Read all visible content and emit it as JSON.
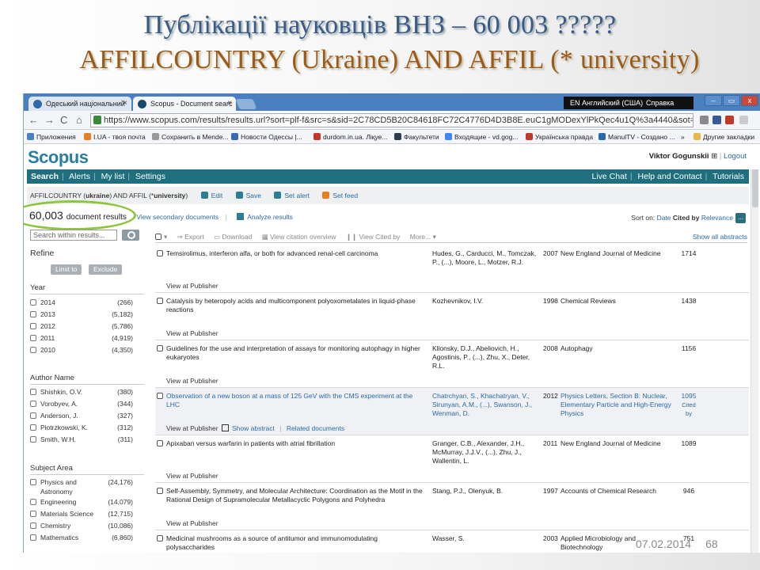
{
  "slide": {
    "title_line1": "Публікації науковців ВНЗ – 60 003 ?????",
    "title_line2": "AFFILCOUNTRY (Ukraine)  AND AFFIL (* university)",
    "date": "07.02.2014",
    "page": "68"
  },
  "browser": {
    "tabs": [
      {
        "label": "Одеський національний"
      },
      {
        "label": "Scopus - Document searc"
      }
    ],
    "tab_close": "×",
    "language": "EN Английский (США)",
    "help": "Справка",
    "url": "https://www.scopus.com/results/results.url?sort=plf-f&src=s&sid=2C78CD5B20C84618FC72C4776D4D3B8E.euC1gMODexYlPkQec4u1Q%3a4440&sot=",
    "bookmarks": [
      "Приложения",
      "I.UA - твоя почта",
      "Сохранить в Mende...",
      "Новости Одессы |...",
      "durdom.in.ua. Ліқуе...",
      "Факультети",
      "Входящие - vd.gog...",
      "Українська правда",
      "ManulTV - Создано ...",
      "»",
      "Другие закладки"
    ]
  },
  "scopus": {
    "logo": "Scopus",
    "user": "Viktor Gogunskii",
    "user_box": "⊞",
    "logout": "Logout",
    "nav_left": [
      "Search",
      "Alerts",
      "My list",
      "Settings"
    ],
    "nav_right": [
      "Live Chat",
      "Help and Contact",
      "Tutorials"
    ],
    "query_prefix": "AFFILCOUNTRY (",
    "query_bold1": "ukraine",
    "query_mid": ") AND AFFIL (*",
    "query_bold2": "university",
    "query_suffix": ")",
    "query_actions": [
      "Edit",
      "Save",
      "Set alert",
      "Set feed"
    ],
    "results_count": "60,003",
    "results_label": "document results",
    "view_secondary": "View secondary documents",
    "analyze": "Analyze results",
    "sort_on": "Sort on:",
    "sort_options": [
      "Date",
      "Cited by",
      "Relevance"
    ],
    "sort_more": "...",
    "search_within_placeholder": "Search within results...",
    "refine": "Refine",
    "limit_to": "Limit to",
    "exclude": "Exclude",
    "toolbar": [
      "Export",
      "Download",
      "View citation overview",
      "View Cited by",
      "More..."
    ],
    "show_all_abstracts": "Show all abstracts",
    "facets": [
      {
        "title": "Year",
        "items": [
          [
            "2014",
            "(266)"
          ],
          [
            "2013",
            "(5,182)"
          ],
          [
            "2012",
            "(5,786)"
          ],
          [
            "2011",
            "(4,919)"
          ],
          [
            "2010",
            "(4,350)"
          ]
        ]
      },
      {
        "title": "Author Name",
        "items": [
          [
            "Shishkin, O.V.",
            "(380)"
          ],
          [
            "Vorobyev, A.",
            "(344)"
          ],
          [
            "Anderson, J.",
            "(327)"
          ],
          [
            "Piotrzkowski, K.",
            "(312)"
          ],
          [
            "Smith, W.H.",
            "(311)"
          ]
        ]
      },
      {
        "title": "Subject Area",
        "items": [
          [
            "Physics and Astronomy",
            "(24,176)"
          ],
          [
            "Engineering",
            "(14,079)"
          ],
          [
            "Materials Science",
            "(12,715)"
          ],
          [
            "Chemistry",
            "(10,086)"
          ],
          [
            "Mathematics",
            "(6,860)"
          ]
        ]
      }
    ],
    "view_at_publisher": "View at Publisher",
    "show_abstract": "Show abstract",
    "related_documents": "Related documents",
    "results": [
      {
        "title": "Temsirolimus, interferon alfa, or both for advanced renal-cell carcinoma",
        "authors": "Hudes, G., Carducci, M., Tomczak, P., (...), Moore, L., Motzer, R.J.",
        "year": "2007",
        "source": "New England Journal of Medicine",
        "cited": "1714"
      },
      {
        "title": "Catalysis by heteropoly acids and multicomponent polyoxometalates in liquid-phase reactions",
        "authors": "Kozhevnikov, I.V.",
        "year": "1998",
        "source": "Chemical Reviews",
        "cited": "1438"
      },
      {
        "title": "Guidelines for the use and interpretation of assays for monitoring autophagy in higher eukaryotes",
        "authors": "Klionsky, D.J., Abeliovich, H., Agostinis, P., (...), Zhu, X., Deter, R.L.",
        "year": "2008",
        "source": "Autophagy",
        "cited": "1156"
      },
      {
        "title": "Observation of a new boson at a mass of 125 GeV with the CMS experiment at the LHC",
        "authors": "Chatrchyan, S., Khachatryan, V., Sirunyan, A.M., (...), Swanson, J., Wenman, D.",
        "year": "2012",
        "source": "Physics Letters, Section B: Nuclear, Elementary Particle and High-Energy Physics",
        "cited": "1095",
        "cited_by": "Cited by"
      },
      {
        "title": "Apixaban versus warfarin in patients with atrial fibrillation",
        "authors": "Granger, C.B., Alexander, J.H., McMurray, J.J.V., (...), Zhu, J., Wallentin, L.",
        "year": "2011",
        "source": "New England Journal of Medicine",
        "cited": "1089"
      },
      {
        "title": "Self-Assembly, Symmetry, and Molecular Architecture: Coordination as the Motif in the Rational Design of Supramolecular Metallacyclic Polygons and Polyhedra",
        "authors": "Stang, P.J., Olenyuk, B.",
        "year": "1997",
        "source": "Accounts of Chemical Research",
        "cited": "946"
      },
      {
        "title": "Medicinal mushrooms as a source of antitumor and immunomodulating polysaccharides",
        "authors": "Wasser, S.",
        "year": "2003",
        "source": "Applied Microbiology and Biotechnology",
        "cited": "751"
      }
    ]
  }
}
